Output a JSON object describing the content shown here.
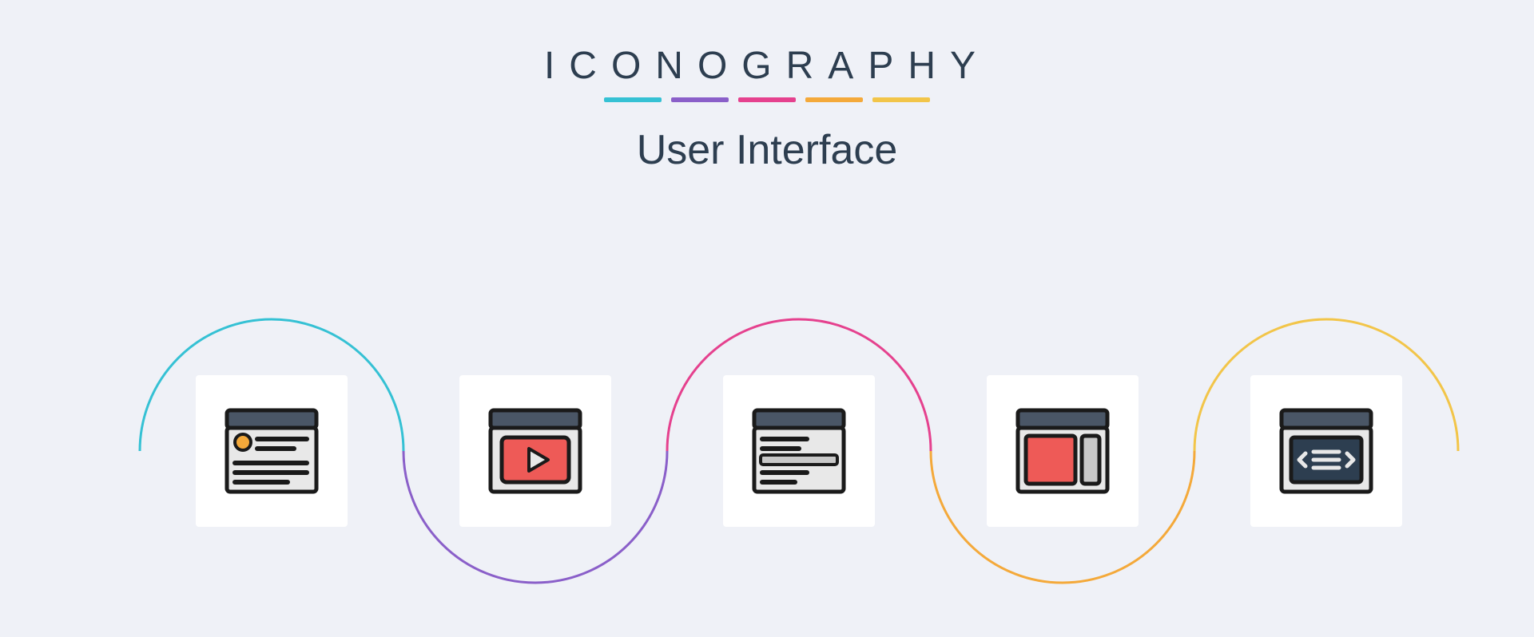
{
  "header": {
    "brand": "ICONOGRAPHY",
    "subtitle": "User Interface",
    "underline_colors": [
      "#35c1d4",
      "#8a5fc9",
      "#e5418e",
      "#f4a93a",
      "#f2c549"
    ]
  },
  "icons": [
    {
      "name": "blog-window-icon",
      "accent": "#35c1d4"
    },
    {
      "name": "video-player-icon",
      "accent": "#8a5fc9"
    },
    {
      "name": "text-editor-icon",
      "accent": "#e5418e"
    },
    {
      "name": "sidebar-layout-icon",
      "accent": "#f4a93a"
    },
    {
      "name": "code-window-icon",
      "accent": "#f2c549"
    }
  ],
  "colors": {
    "red": "#ee5a57",
    "orange": "#f4a93a",
    "navy": "#2d3e50",
    "gray_win": "#4a5666"
  }
}
